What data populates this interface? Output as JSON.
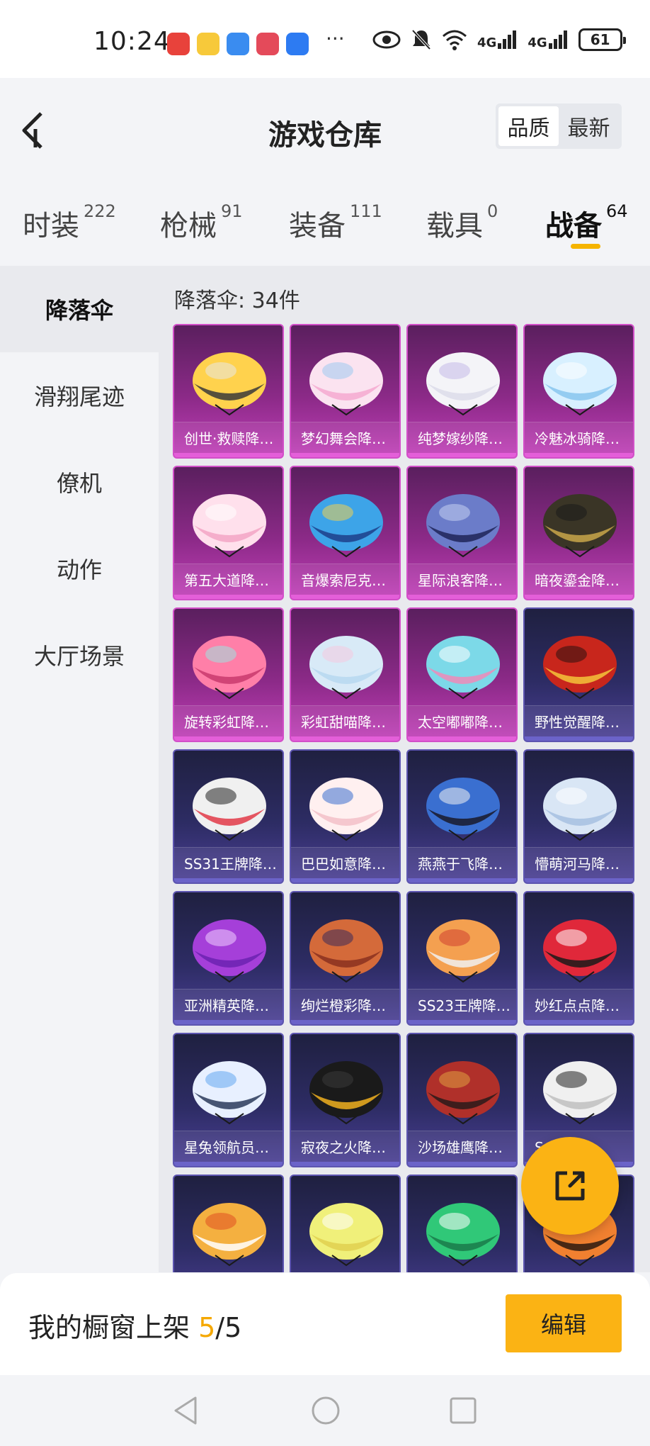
{
  "status_bar": {
    "time": "10:24",
    "more": "···",
    "network_1": "4G",
    "network_2": "4G",
    "battery": "61"
  },
  "header": {
    "title": "游戏仓库",
    "sort_options": [
      "品质",
      "最新"
    ],
    "active_sort": "品质"
  },
  "tabs": [
    {
      "label": "时装",
      "count": "222"
    },
    {
      "label": "枪械",
      "count": "91"
    },
    {
      "label": "装备",
      "count": "111"
    },
    {
      "label": "载具",
      "count": "0"
    },
    {
      "label": "战备",
      "count": "64"
    }
  ],
  "active_tab": "战备",
  "sidebar": {
    "items": [
      "降落伞",
      "滑翔尾迹",
      "僚机",
      "动作",
      "大厅场景"
    ],
    "active": "降落伞"
  },
  "content": {
    "count_label": "降落伞: 34件",
    "items": [
      {
        "name": "创世·救赎降…",
        "rarity": "purple"
      },
      {
        "name": "梦幻舞会降…",
        "rarity": "purple"
      },
      {
        "name": "纯梦嫁纱降…",
        "rarity": "purple"
      },
      {
        "name": "冷魅冰骑降…",
        "rarity": "purple"
      },
      {
        "name": "第五大道降…",
        "rarity": "purple"
      },
      {
        "name": "音爆索尼克…",
        "rarity": "purple"
      },
      {
        "name": "星际浪客降…",
        "rarity": "purple"
      },
      {
        "name": "暗夜鎏金降…",
        "rarity": "purple"
      },
      {
        "name": "旋转彩虹降…",
        "rarity": "purple"
      },
      {
        "name": "彩虹甜喵降…",
        "rarity": "purple"
      },
      {
        "name": "太空嘟嘟降…",
        "rarity": "purple"
      },
      {
        "name": "野性觉醒降…",
        "rarity": "blue"
      },
      {
        "name": "SS31王牌降…",
        "rarity": "blue"
      },
      {
        "name": "巴巴如意降…",
        "rarity": "blue"
      },
      {
        "name": "燕燕于飞降…",
        "rarity": "blue"
      },
      {
        "name": "懵萌河马降…",
        "rarity": "blue"
      },
      {
        "name": "亚洲精英降…",
        "rarity": "blue"
      },
      {
        "name": "绚烂橙彩降…",
        "rarity": "blue"
      },
      {
        "name": "SS23王牌降…",
        "rarity": "blue"
      },
      {
        "name": "妙红点点降…",
        "rarity": "blue"
      },
      {
        "name": "星兔领航员…",
        "rarity": "blue"
      },
      {
        "name": "寂夜之火降…",
        "rarity": "blue"
      },
      {
        "name": "沙场雄鹰降…",
        "rarity": "blue"
      },
      {
        "name": "S…降…",
        "rarity": "blue"
      },
      {
        "name": "",
        "rarity": "blue"
      },
      {
        "name": "",
        "rarity": "blue"
      },
      {
        "name": "",
        "rarity": "blue"
      },
      {
        "name": "",
        "rarity": "blue"
      }
    ]
  },
  "bottom_bar": {
    "label": "我的橱窗上架",
    "current": "5",
    "separator": "/",
    "total": "5",
    "edit_button": "编辑"
  },
  "colors": {
    "accent": "#fbb314",
    "purple_card": "#8c2a88",
    "blue_card": "#2d2c64"
  }
}
